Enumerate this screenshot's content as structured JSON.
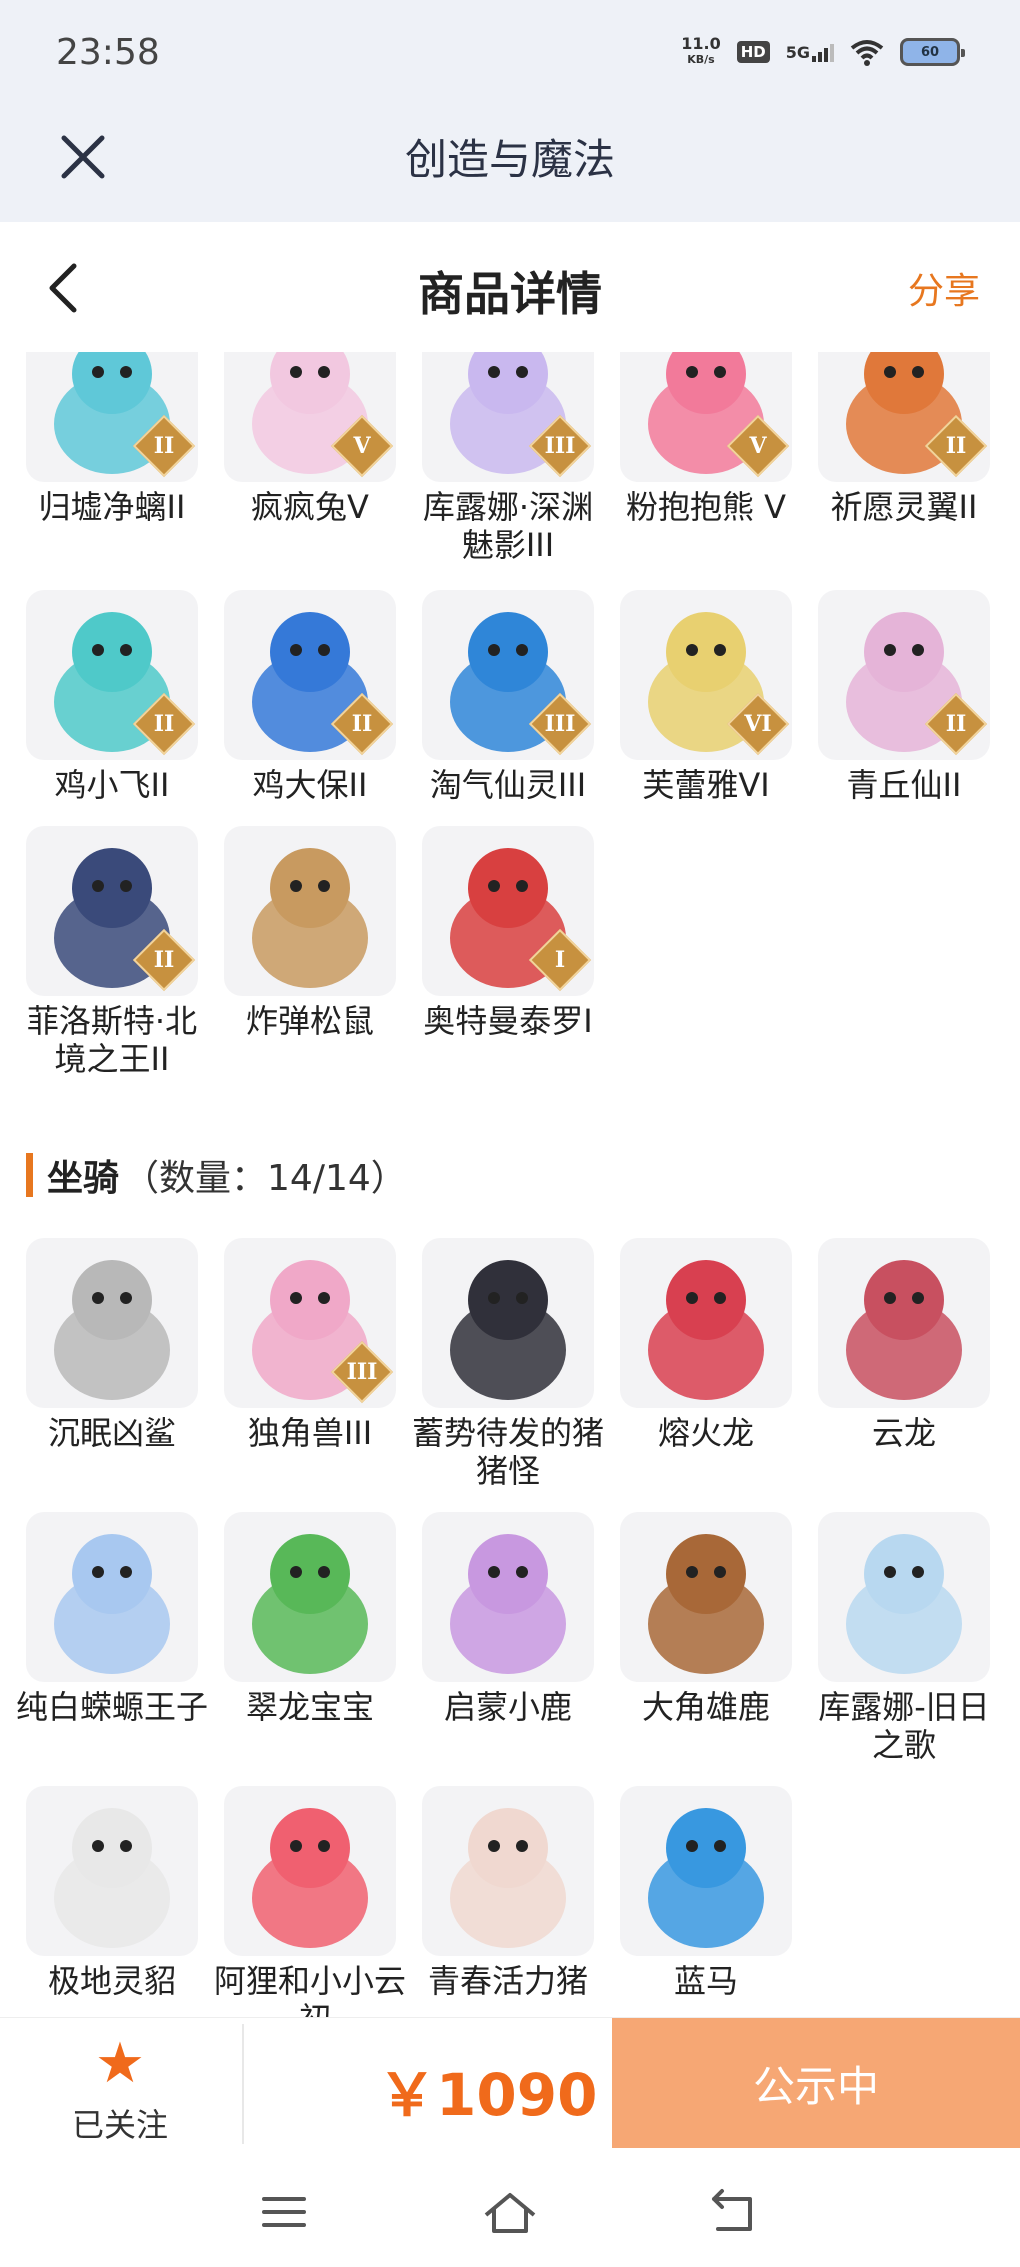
{
  "status_bar": {
    "time": "23:58",
    "net_speed_value": "11.0",
    "net_speed_unit": "KB/s",
    "hd": "HD",
    "network": "5G",
    "battery": "60"
  },
  "app_bar": {
    "title": "创造与魔法"
  },
  "page_header": {
    "title": "商品详情",
    "share": "分享"
  },
  "characters": [
    {
      "name": "归墟净螭II",
      "badge": "II",
      "color": "#5fc8d8"
    },
    {
      "name": "疯疯兔V",
      "badge": "V",
      "color": "#f2c8e0"
    },
    {
      "name": "库露娜·深渊魅影III",
      "badge": "III",
      "color": "#c9b8ef"
    },
    {
      "name": "粉抱抱熊 V",
      "badge": "V",
      "color": "#f27a9a"
    },
    {
      "name": "祈愿灵翼II",
      "badge": "II",
      "color": "#e0783a"
    },
    {
      "name": "鸡小飞II",
      "badge": "II",
      "color": "#4fc9c9"
    },
    {
      "name": "鸡大保II",
      "badge": "II",
      "color": "#3579d8"
    },
    {
      "name": "淘气仙灵III",
      "badge": "III",
      "color": "#2f86d8"
    },
    {
      "name": "芙蕾雅VI",
      "badge": "VI",
      "color": "#e8d070"
    },
    {
      "name": "青丘仙II",
      "badge": "II",
      "color": "#e5b4d8"
    },
    {
      "name": "菲洛斯特·北境之王II",
      "badge": "II",
      "color": "#3a4a7a"
    },
    {
      "name": "炸弹松鼠",
      "badge": "",
      "color": "#c89a60"
    },
    {
      "name": "奥特曼泰罗I",
      "badge": "I",
      "color": "#d84040"
    }
  ],
  "mounts_section": {
    "title": "坐骑",
    "count": "（数量：14/14）"
  },
  "mounts": [
    {
      "name": "沉眠凶鲨",
      "badge": "",
      "color": "#b8b8b8"
    },
    {
      "name": "独角兽III",
      "badge": "III",
      "color": "#f0a8c8"
    },
    {
      "name": "蓄势待发的猪猪怪",
      "badge": "",
      "color": "#30303a"
    },
    {
      "name": "熔火龙",
      "badge": "",
      "color": "#d84050"
    },
    {
      "name": "云龙",
      "badge": "",
      "color": "#c85060"
    },
    {
      "name": "纯白蝾螈王子",
      "badge": "",
      "color": "#a8c8f0"
    },
    {
      "name": "翠龙宝宝",
      "badge": "",
      "color": "#58b858"
    },
    {
      "name": "启蒙小鹿",
      "badge": "",
      "color": "#c898e0"
    },
    {
      "name": "大角雄鹿",
      "badge": "",
      "color": "#a86838"
    },
    {
      "name": "库露娜-旧日之歌",
      "badge": "",
      "color": "#b8d8f0"
    },
    {
      "name": "极地灵貂",
      "badge": "",
      "color": "#e8e8e8"
    },
    {
      "name": "阿狸和小小云·初",
      "badge": "",
      "color": "#f06070"
    },
    {
      "name": "青春活力猪",
      "badge": "",
      "color": "#f0d8d0"
    },
    {
      "name": "蓝马",
      "badge": "",
      "color": "#3898e0"
    }
  ],
  "bottom_bar": {
    "follow_label": "已关注",
    "price": "￥1090",
    "action": "公示中"
  }
}
